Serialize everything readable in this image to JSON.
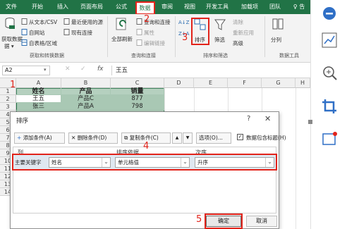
{
  "tabs": [
    {
      "label": "文件"
    },
    {
      "label": "开始"
    },
    {
      "label": "插入"
    },
    {
      "label": "页面布局"
    },
    {
      "label": "公式"
    },
    {
      "label": "数据"
    },
    {
      "label": "审阅"
    },
    {
      "label": "视图"
    },
    {
      "label": "开发工具"
    },
    {
      "label": "加载项"
    },
    {
      "label": "团队"
    },
    {
      "label": "♀ 告"
    }
  ],
  "ribbon": {
    "get_data_label": "获取数据",
    "get_data_label2": "据 ▾",
    "from_text_csv": "从文本/CSV",
    "from_web": "自网站",
    "from_table": "自表格/区域",
    "recent_sources": "最近使用的源",
    "existing_connections": "现有连接",
    "group_get_transform": "获取和转换数据",
    "refresh_all": "全部刷新",
    "queries_connections": "查询和连接",
    "properties": "属性",
    "edit_links": "编辑链接",
    "group_queries": "查询和连接",
    "sort_asc": "A↓Z",
    "sort_desc": "Z↓A",
    "sort": "排序",
    "filter": "筛选",
    "clear": "清除",
    "reapply": "重新应用",
    "advanced": "高级",
    "group_sort_filter": "排序和筛选",
    "split": "分列",
    "group_data_tools": "数据工具"
  },
  "formula_bar": {
    "namebox": "A2",
    "formula": "王五"
  },
  "grid": {
    "columns": [
      "A",
      "B",
      "C",
      "D",
      "E",
      "F",
      "G",
      "H"
    ],
    "rows": [
      "1",
      "2",
      "3",
      "4",
      "5",
      "6",
      "7",
      "8",
      "9",
      "10",
      "11",
      "12",
      "13",
      "14"
    ],
    "header": [
      "姓名",
      "产品",
      "销量"
    ],
    "data_rows": [
      [
        "王五",
        "产品C",
        "877"
      ],
      [
        "张三",
        "产品A",
        "798"
      ]
    ]
  },
  "dialog": {
    "title": "排序",
    "help": "?",
    "close": "✕",
    "add_condition": "添加条件(A)",
    "delete_condition": "删除条件(D)",
    "copy_condition": "复制条件(C)",
    "up_arrow": "▲",
    "down_arrow": "▼",
    "options": "选项(O)...",
    "has_header_checkbox": "数据包含标题(H)",
    "col_header": "列",
    "sort_on_header": "排序依据",
    "order_header": "次序",
    "primary_key_label": "主要关键字",
    "primary_key_value": "姓名",
    "sort_on_value": "单元格值",
    "order_value": "升序",
    "ok": "确定",
    "cancel": "取消"
  },
  "annotations": {
    "n1": "1",
    "n2": "2",
    "n3": "3",
    "n4": "4",
    "n5": "5"
  },
  "colors": {
    "excel_green": "#217346",
    "highlight_red": "#e2231a",
    "selection_fill": "#a9c8b4"
  }
}
